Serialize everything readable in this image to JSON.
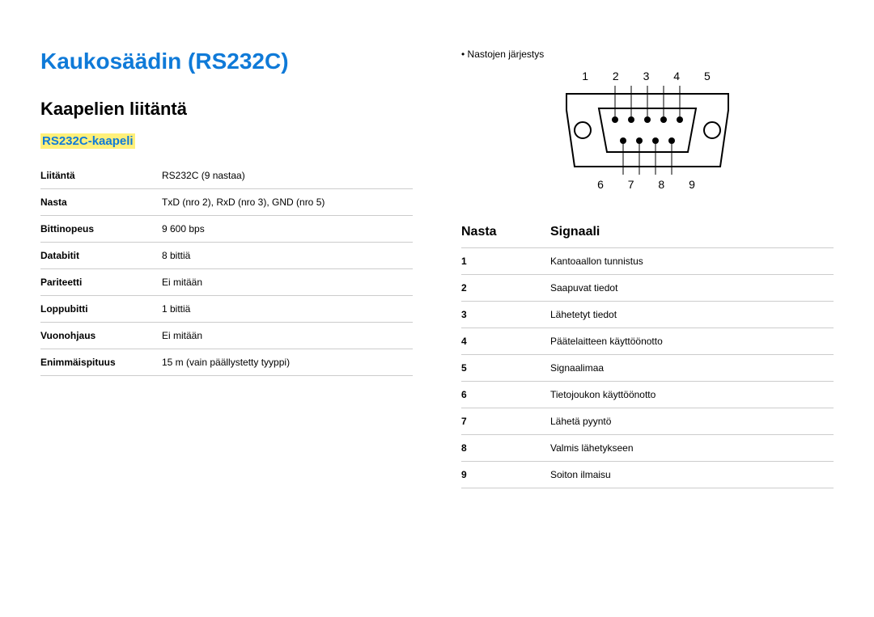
{
  "title": "Kaukosäädin (RS232C)",
  "section": "Kaapelien liitäntä",
  "subsection": "RS232C-kaapeli",
  "specs": [
    {
      "label": "Liitäntä",
      "value": "RS232C (9 nastaa)"
    },
    {
      "label": "Nasta",
      "value": "TxD (nro 2), RxD (nro 3), GND (nro 5)"
    },
    {
      "label": "Bittinopeus",
      "value": "9 600 bps"
    },
    {
      "label": "Databitit",
      "value": "8 bittiä"
    },
    {
      "label": "Pariteetti",
      "value": "Ei mitään"
    },
    {
      "label": "Loppubitti",
      "value": "1 bittiä"
    },
    {
      "label": "Vuonohjaus",
      "value": "Ei mitään"
    },
    {
      "label": "Enimmäispituus",
      "value": "15 m (vain päällystetty tyyppi)"
    }
  ],
  "pin_arrangement_label": "Nastojen järjestys",
  "pins_top": "1  2  3  4  5",
  "pins_bottom": "6  7  8  9",
  "signal_table": {
    "headers": {
      "pin": "Nasta",
      "signal": "Signaali"
    },
    "rows": [
      {
        "pin": "1",
        "signal": "Kantoaallon tunnistus"
      },
      {
        "pin": "2",
        "signal": "Saapuvat tiedot"
      },
      {
        "pin": "3",
        "signal": "Lähetetyt tiedot"
      },
      {
        "pin": "4",
        "signal": "Päätelaitteen käyttöönotto"
      },
      {
        "pin": "5",
        "signal": "Signaalimaa"
      },
      {
        "pin": "6",
        "signal": "Tietojoukon käyttöönotto"
      },
      {
        "pin": "7",
        "signal": "Lähetä pyyntö"
      },
      {
        "pin": "8",
        "signal": "Valmis lähetykseen"
      },
      {
        "pin": "9",
        "signal": "Soiton ilmaisu"
      }
    ]
  }
}
